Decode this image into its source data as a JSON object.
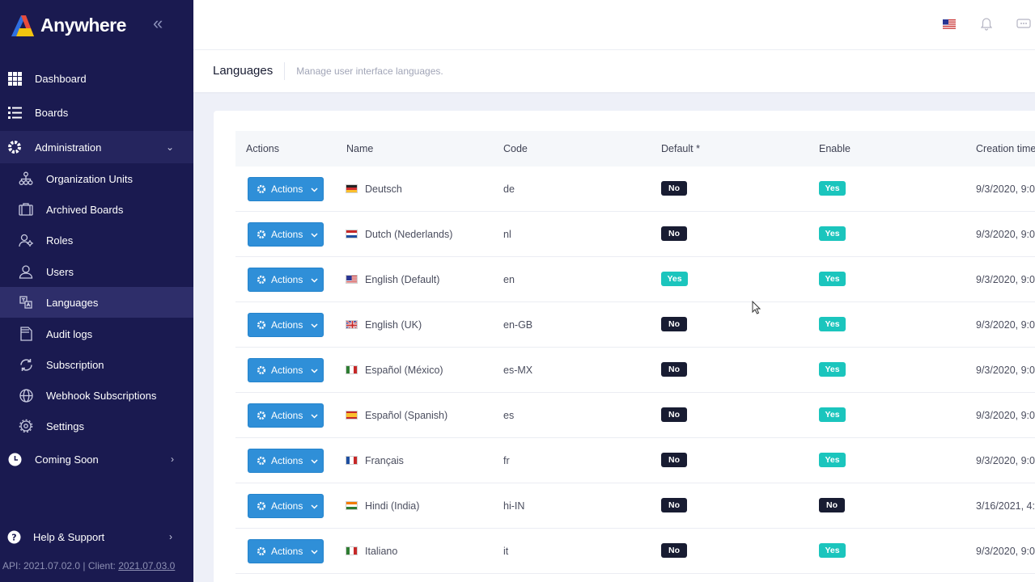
{
  "brand": {
    "name": "Anywhere"
  },
  "sidebar": {
    "items": [
      {
        "label": "Dashboard",
        "icon": "grid-icon"
      },
      {
        "label": "Boards",
        "icon": "list-icon"
      },
      {
        "label": "Administration",
        "icon": "gear-icon"
      },
      {
        "label": "Organization Units",
        "icon": "org-units-icon"
      },
      {
        "label": "Archived Boards",
        "icon": "archive-icon"
      },
      {
        "label": "Roles",
        "icon": "roles-icon"
      },
      {
        "label": "Users",
        "icon": "users-icon"
      },
      {
        "label": "Languages",
        "icon": "languages-icon"
      },
      {
        "label": "Audit logs",
        "icon": "audit-icon"
      },
      {
        "label": "Subscription",
        "icon": "refresh-icon"
      },
      {
        "label": "Webhook Subscriptions",
        "icon": "globe-icon"
      },
      {
        "label": "Settings",
        "icon": "settings-icon"
      },
      {
        "label": "Coming Soon",
        "icon": "clock-icon"
      },
      {
        "label": "Help & Support",
        "icon": "help-icon"
      }
    ],
    "version_prefix": "API: 2021.07.02.0 | Client: ",
    "version_client": "2021.07.03.0"
  },
  "header": {
    "title": "Languages",
    "description": "Manage user interface languages."
  },
  "table": {
    "columns": [
      "Actions",
      "Name",
      "Code",
      "Default *",
      "Enable",
      "Creation time"
    ],
    "action_label": "Actions",
    "rows": [
      {
        "name": "Deutsch",
        "code": "de",
        "flag": "de",
        "default": "No",
        "enable": "Yes",
        "created": "9/3/2020, 9:0"
      },
      {
        "name": "Dutch (Nederlands)",
        "code": "nl",
        "flag": "nl",
        "default": "No",
        "enable": "Yes",
        "created": "9/3/2020, 9:0"
      },
      {
        "name": "English (Default)",
        "code": "en",
        "flag": "us",
        "default": "Yes",
        "enable": "Yes",
        "created": "9/3/2020, 9:0"
      },
      {
        "name": "English (UK)",
        "code": "en-GB",
        "flag": "gb",
        "default": "No",
        "enable": "Yes",
        "created": "9/3/2020, 9:0"
      },
      {
        "name": "Español (México)",
        "code": "es-MX",
        "flag": "mx",
        "default": "No",
        "enable": "Yes",
        "created": "9/3/2020, 9:0"
      },
      {
        "name": "Español (Spanish)",
        "code": "es",
        "flag": "es",
        "default": "No",
        "enable": "Yes",
        "created": "9/3/2020, 9:0"
      },
      {
        "name": "Français",
        "code": "fr",
        "flag": "fr",
        "default": "No",
        "enable": "Yes",
        "created": "9/3/2020, 9:0"
      },
      {
        "name": "Hindi (India)",
        "code": "hi-IN",
        "flag": "in",
        "default": "No",
        "enable": "No",
        "created": "3/16/2021, 4:"
      },
      {
        "name": "Italiano",
        "code": "it",
        "flag": "it",
        "default": "No",
        "enable": "Yes",
        "created": "9/3/2020, 9:0"
      }
    ]
  },
  "colors": {
    "sidebar_bg": "#1a1a50",
    "action_blue": "#2f8fd8",
    "badge_yes": "#1bc5bd",
    "badge_no": "#181c32"
  }
}
